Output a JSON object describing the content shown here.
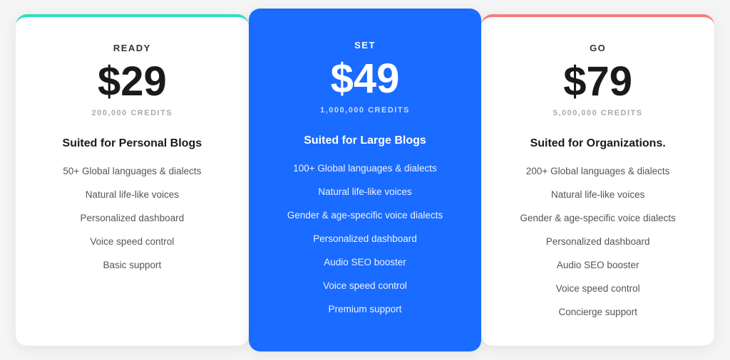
{
  "plans": [
    {
      "id": "ready",
      "name": "READY",
      "price": "$29",
      "credits": "200,000 CREDITS",
      "tagline": "Suited for Personal Blogs",
      "features": [
        "50+ Global languages & dialects",
        "Natural life-like voices",
        "Personalized dashboard",
        "Voice speed control",
        "Basic support"
      ],
      "featured": false,
      "borderColor": "#2de0c0"
    },
    {
      "id": "set",
      "name": "SET",
      "price": "$49",
      "credits": "1,000,000 CREDITS",
      "tagline": "Suited for Large Blogs",
      "features": [
        "100+ Global languages & dialects",
        "Natural life-like voices",
        "Gender & age-specific voice dialects",
        "Personalized dashboard",
        "Audio SEO booster",
        "Voice speed control",
        "Premium support"
      ],
      "featured": true,
      "borderColor": "#1a6bff"
    },
    {
      "id": "go",
      "name": "GO",
      "price": "$79",
      "credits": "5,000,000 CREDITS",
      "tagline": "Suited for Organizations.",
      "features": [
        "200+ Global languages & dialects",
        "Natural life-like voices",
        "Gender & age-specific voice dialects",
        "Personalized dashboard",
        "Audio SEO booster",
        "Voice speed control",
        "Concierge support"
      ],
      "featured": false,
      "borderColor": "#f87c7c"
    }
  ]
}
